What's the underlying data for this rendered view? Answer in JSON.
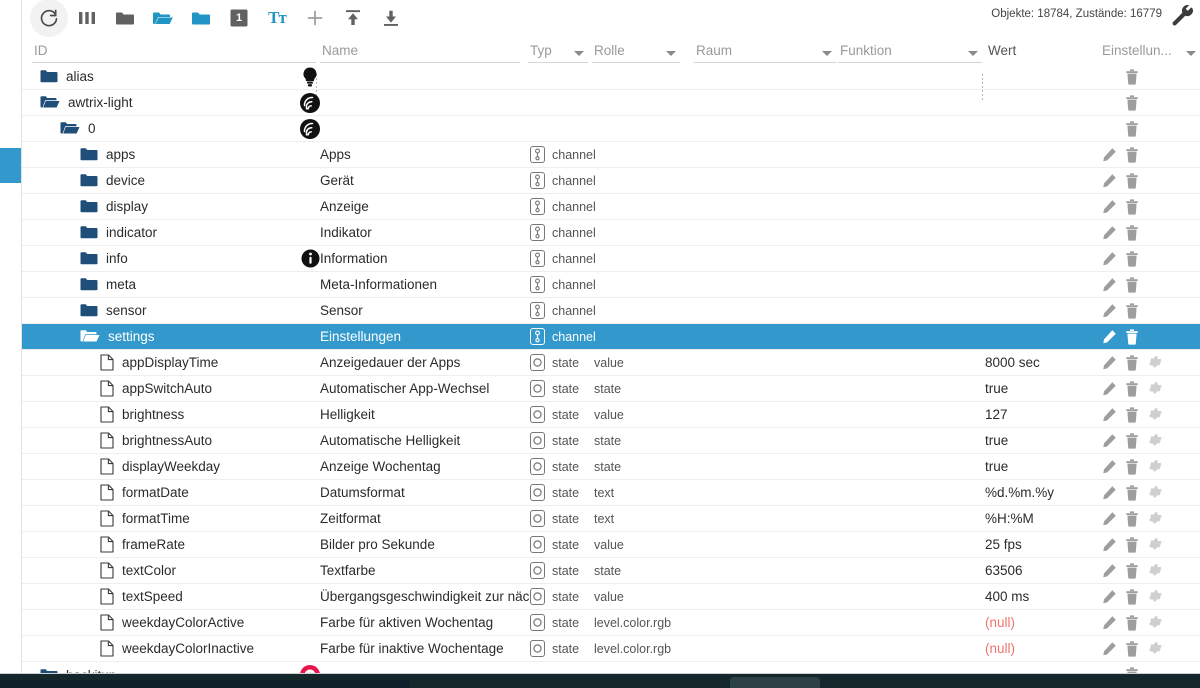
{
  "toolbar": {
    "buttons": [
      {
        "name": "refresh-icon",
        "title": "refresh"
      },
      {
        "name": "columns-icon",
        "title": "columns"
      },
      {
        "name": "folder-collapse-icon",
        "title": "collapse all"
      },
      {
        "name": "folder-open-icon",
        "title": "expand all"
      },
      {
        "name": "folder-filled-icon",
        "title": "folder"
      },
      {
        "name": "expand-level-icon",
        "title": "1"
      },
      {
        "name": "text-size-icon",
        "title": "Tt"
      },
      {
        "name": "add-icon",
        "title": "+"
      },
      {
        "name": "upload-icon",
        "title": "import"
      },
      {
        "name": "download-icon",
        "title": "export"
      }
    ],
    "level_badge": "1",
    "text_icon": "Tт",
    "status": "Objekte: 18784, Zustände: 16779",
    "wrench_name": "wrench-icon"
  },
  "filters": {
    "id": "ID",
    "name": "Name",
    "typ": "Typ",
    "rolle": "Rolle",
    "raum": "Raum",
    "funktion": "Funktion",
    "wert": "Wert",
    "einstellungen": "Einstellun..."
  },
  "rows": [
    {
      "id": "alias",
      "indent": 0,
      "icon": "folder-filled",
      "mid": "bulb",
      "name": "",
      "type": "",
      "role": "",
      "value": "",
      "actions": [
        "delete"
      ],
      "selected": false
    },
    {
      "id": "awtrix-light",
      "indent": 0,
      "icon": "folder-open",
      "mid": "signal",
      "name": "",
      "type": "",
      "role": "",
      "value": "",
      "actions": [
        "delete"
      ],
      "selected": false
    },
    {
      "id": "0",
      "indent": 1,
      "icon": "folder-open",
      "mid": "signal",
      "name": "",
      "type": "",
      "role": "",
      "value": "",
      "actions": [
        "delete"
      ],
      "selected": false
    },
    {
      "id": "apps",
      "indent": 2,
      "icon": "folder-filled",
      "mid": "",
      "name": "Apps",
      "type": "channel",
      "role": "",
      "value": "",
      "actions": [
        "edit",
        "delete"
      ],
      "selected": false
    },
    {
      "id": "device",
      "indent": 2,
      "icon": "folder-filled",
      "mid": "",
      "name": "Gerät",
      "type": "channel",
      "role": "",
      "value": "",
      "actions": [
        "edit",
        "delete"
      ],
      "selected": false
    },
    {
      "id": "display",
      "indent": 2,
      "icon": "folder-filled",
      "mid": "",
      "name": "Anzeige",
      "type": "channel",
      "role": "",
      "value": "",
      "actions": [
        "edit",
        "delete"
      ],
      "selected": false
    },
    {
      "id": "indicator",
      "indent": 2,
      "icon": "folder-filled",
      "mid": "",
      "name": "Indikator",
      "type": "channel",
      "role": "",
      "value": "",
      "actions": [
        "edit",
        "delete"
      ],
      "selected": false
    },
    {
      "id": "info",
      "indent": 2,
      "icon": "folder-filled",
      "mid": "info",
      "name": "Information",
      "type": "channel",
      "role": "",
      "value": "",
      "actions": [
        "edit",
        "delete"
      ],
      "selected": false
    },
    {
      "id": "meta",
      "indent": 2,
      "icon": "folder-filled",
      "mid": "",
      "name": "Meta-Informationen",
      "type": "channel",
      "role": "",
      "value": "",
      "actions": [
        "edit",
        "delete"
      ],
      "selected": false
    },
    {
      "id": "sensor",
      "indent": 2,
      "icon": "folder-filled",
      "mid": "",
      "name": "Sensor",
      "type": "channel",
      "role": "",
      "value": "",
      "actions": [
        "edit",
        "delete"
      ],
      "selected": false
    },
    {
      "id": "settings",
      "indent": 2,
      "icon": "folder-open",
      "mid": "",
      "name": "Einstellungen",
      "type": "channel",
      "role": "",
      "value": "",
      "actions": [
        "edit",
        "delete"
      ],
      "selected": true
    },
    {
      "id": "appDisplayTime",
      "indent": 3,
      "icon": "file",
      "mid": "",
      "name": "Anzeigedauer der Apps",
      "type": "state",
      "role": "value",
      "value": "8000 sec",
      "actions": [
        "edit",
        "delete",
        "settings"
      ],
      "selected": false
    },
    {
      "id": "appSwitchAuto",
      "indent": 3,
      "icon": "file",
      "mid": "",
      "name": "Automatischer App-Wechsel",
      "type": "state",
      "role": "state",
      "value": "true",
      "actions": [
        "edit",
        "delete",
        "settings"
      ],
      "selected": false
    },
    {
      "id": "brightness",
      "indent": 3,
      "icon": "file",
      "mid": "",
      "name": "Helligkeit",
      "type": "state",
      "role": "value",
      "value": "127",
      "actions": [
        "edit",
        "delete",
        "settings"
      ],
      "selected": false
    },
    {
      "id": "brightnessAuto",
      "indent": 3,
      "icon": "file",
      "mid": "",
      "name": "Automatische Helligkeit",
      "type": "state",
      "role": "state",
      "value": "true",
      "actions": [
        "edit",
        "delete",
        "settings"
      ],
      "selected": false
    },
    {
      "id": "displayWeekday",
      "indent": 3,
      "icon": "file",
      "mid": "",
      "name": "Anzeige Wochentag",
      "type": "state",
      "role": "state",
      "value": "true",
      "actions": [
        "edit",
        "delete",
        "settings"
      ],
      "selected": false
    },
    {
      "id": "formatDate",
      "indent": 3,
      "icon": "file",
      "mid": "",
      "name": "Datumsformat",
      "type": "state",
      "role": "text",
      "value": "%d.%m.%y",
      "actions": [
        "edit",
        "delete",
        "settings"
      ],
      "selected": false
    },
    {
      "id": "formatTime",
      "indent": 3,
      "icon": "file",
      "mid": "",
      "name": "Zeitformat",
      "type": "state",
      "role": "text",
      "value": "%H:%M",
      "actions": [
        "edit",
        "delete",
        "settings"
      ],
      "selected": false
    },
    {
      "id": "frameRate",
      "indent": 3,
      "icon": "file",
      "mid": "",
      "name": "Bilder pro Sekunde",
      "type": "state",
      "role": "value",
      "value": "25 fps",
      "actions": [
        "edit",
        "delete",
        "settings"
      ],
      "selected": false
    },
    {
      "id": "textColor",
      "indent": 3,
      "icon": "file",
      "mid": "",
      "name": "Textfarbe",
      "type": "state",
      "role": "state",
      "value": "63506",
      "actions": [
        "edit",
        "delete",
        "settings"
      ],
      "selected": false
    },
    {
      "id": "textSpeed",
      "indent": 3,
      "icon": "file",
      "mid": "",
      "name": "Übergangsgeschwindigkeit zur nächste...",
      "type": "state",
      "role": "value",
      "value": "400 ms",
      "actions": [
        "edit",
        "delete",
        "settings"
      ],
      "selected": false
    },
    {
      "id": "weekdayColorActive",
      "indent": 3,
      "icon": "file",
      "mid": "",
      "name": "Farbe für aktiven Wochentag",
      "type": "state",
      "role": "level.color.rgb",
      "value": "(null)",
      "value_null": true,
      "actions": [
        "edit",
        "delete",
        "settings"
      ],
      "selected": false
    },
    {
      "id": "weekdayColorInactive",
      "indent": 3,
      "icon": "file",
      "mid": "",
      "name": "Farbe für inaktive Wochentage",
      "type": "state",
      "role": "level.color.rgb",
      "value": "(null)",
      "value_null": true,
      "actions": [
        "edit",
        "delete",
        "settings"
      ],
      "selected": false
    },
    {
      "id": "backitup",
      "indent": 0,
      "icon": "folder-filled",
      "mid": "backitup",
      "name": "",
      "type": "",
      "role": "",
      "value": "",
      "actions": [
        "delete"
      ],
      "selected": false,
      "partial": true
    }
  ],
  "colors": {
    "accent": "#3399cc",
    "folder": "#1f4e79",
    "icon_blue": "#2196c4",
    "null_value": "#f0746b",
    "taskbar": "#16272b"
  }
}
